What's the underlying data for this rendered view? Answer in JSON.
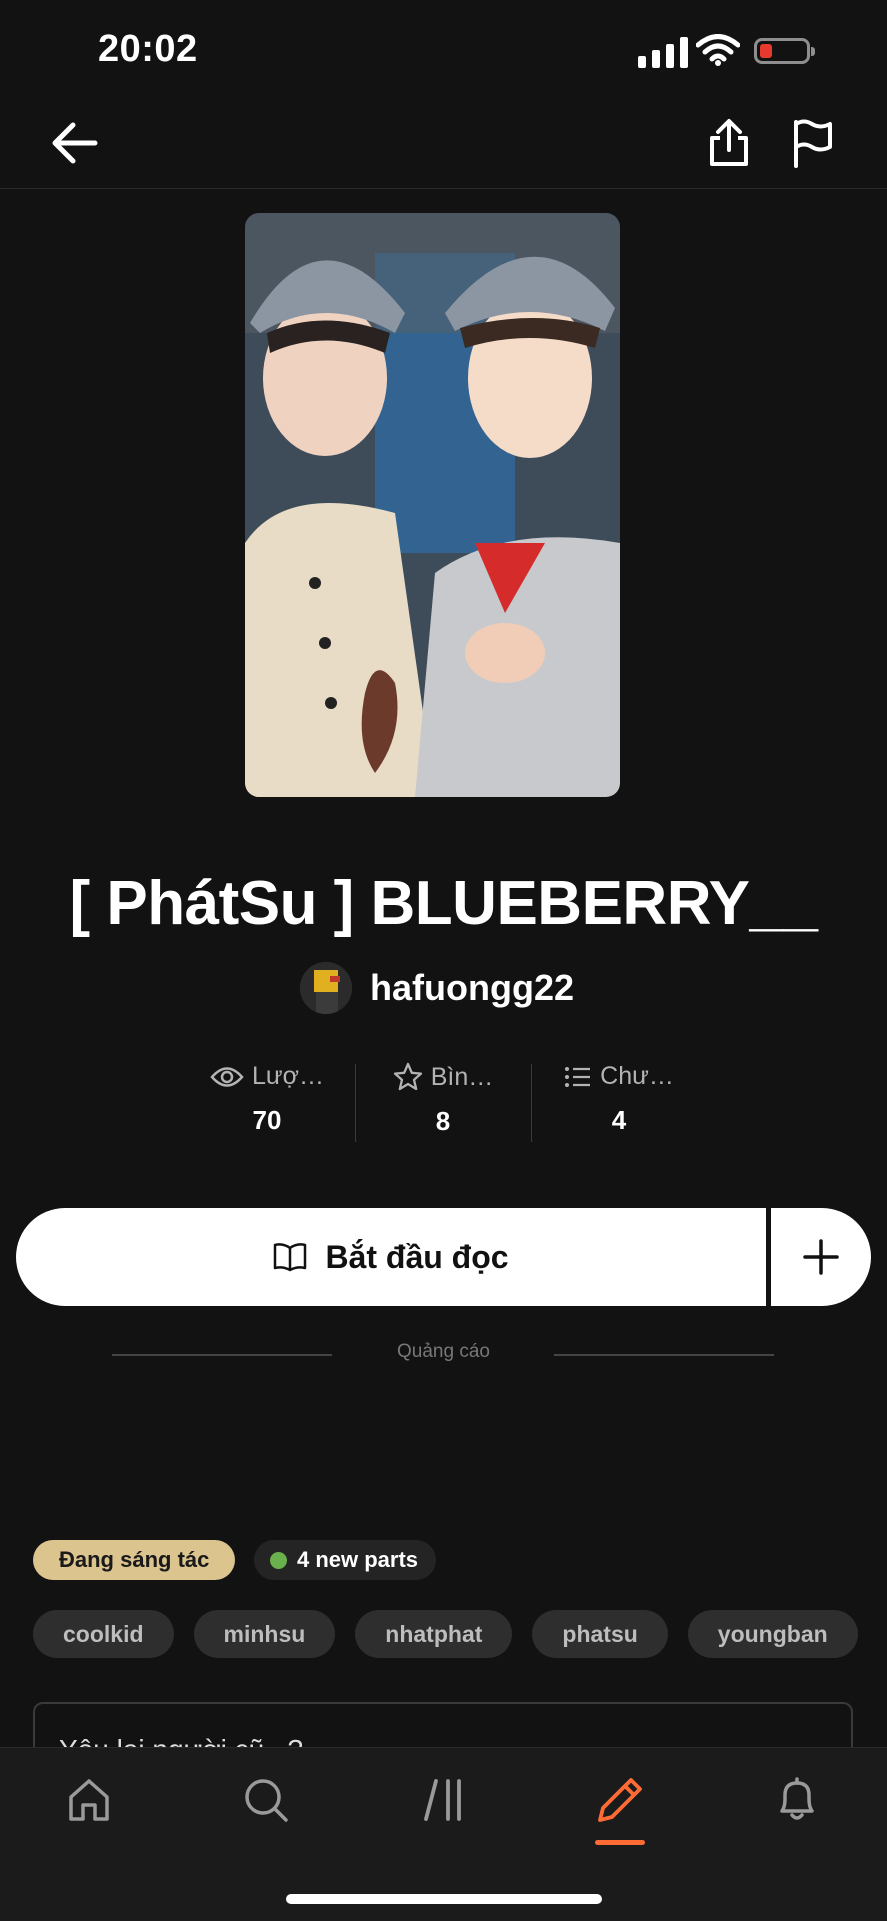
{
  "status_bar": {
    "time": "20:02"
  },
  "nav": {
    "back_icon": "arrow-left-icon",
    "share_icon": "share-icon",
    "report_icon": "flag-icon"
  },
  "story": {
    "title": "[ PhátSu ] BLUEBERRY__",
    "author": "hafuongg22"
  },
  "stats": [
    {
      "icon": "eye-icon",
      "label": "Lượ…",
      "value": "70"
    },
    {
      "icon": "star-icon",
      "label": "Bìn…",
      "value": "8"
    },
    {
      "icon": "list-icon",
      "label": "Chư…",
      "value": "4"
    }
  ],
  "actions": {
    "read_label": "Bắt đầu đọc",
    "add_icon": "plus-icon"
  },
  "ad": {
    "label": "Quảng cáo"
  },
  "badges": {
    "status": "Đang sáng tác",
    "new_parts": "4 new parts"
  },
  "tags": [
    "coolkid",
    "minhsu",
    "nhatphat",
    "phatsu",
    "youngban"
  ],
  "description": {
    "preview": "Yêu lại người cũ...?"
  },
  "tabbar": {
    "items": [
      {
        "icon": "home-icon"
      },
      {
        "icon": "search-icon"
      },
      {
        "icon": "library-icon"
      },
      {
        "icon": "pencil-icon",
        "active": true
      },
      {
        "icon": "bell-icon"
      }
    ],
    "accent": "#ff6b35"
  }
}
